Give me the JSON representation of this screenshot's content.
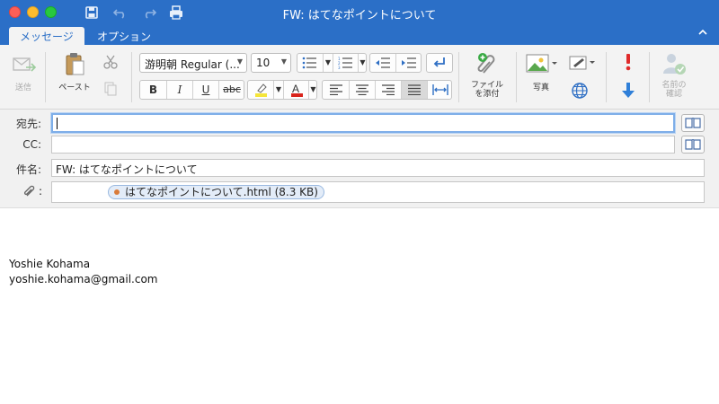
{
  "window": {
    "title": "FW: はてなポイントについて"
  },
  "tabs": [
    {
      "label": "メッセージ",
      "active": true
    },
    {
      "label": "オプション",
      "active": false
    }
  ],
  "ribbon": {
    "send_label": "送信",
    "paste_label": "ペースト",
    "font_name": "游明朝 Regular (...",
    "font_size": "10",
    "format_bold": "B",
    "format_italic": "I",
    "format_underline": "U",
    "format_strike": "abc",
    "attach_file_label_1": "ファイル",
    "attach_file_label_2": "を添付",
    "photo_label": "写真",
    "check_names_label_1": "名前の",
    "check_names_label_2": "確認"
  },
  "fields": {
    "to_label": "宛先:",
    "to_value": "",
    "cc_label": "CC:",
    "cc_value": "",
    "subject_label": "件名:",
    "subject_value": "FW: はてなポイントについて",
    "attachment_name": "はてなポイントについて.html (8.3 KB)",
    "attachment_sep": ":"
  },
  "body": {
    "signature_name": "Yoshie Kohama",
    "signature_email": "yoshie.kohama@gmail.com"
  },
  "colors": {
    "title_blue": "#2b6fc7",
    "highlight_yellow": "#f5e53a",
    "font_red": "#d9241c",
    "priority_high": "#e02b2b",
    "priority_low": "#2f7fd8"
  }
}
